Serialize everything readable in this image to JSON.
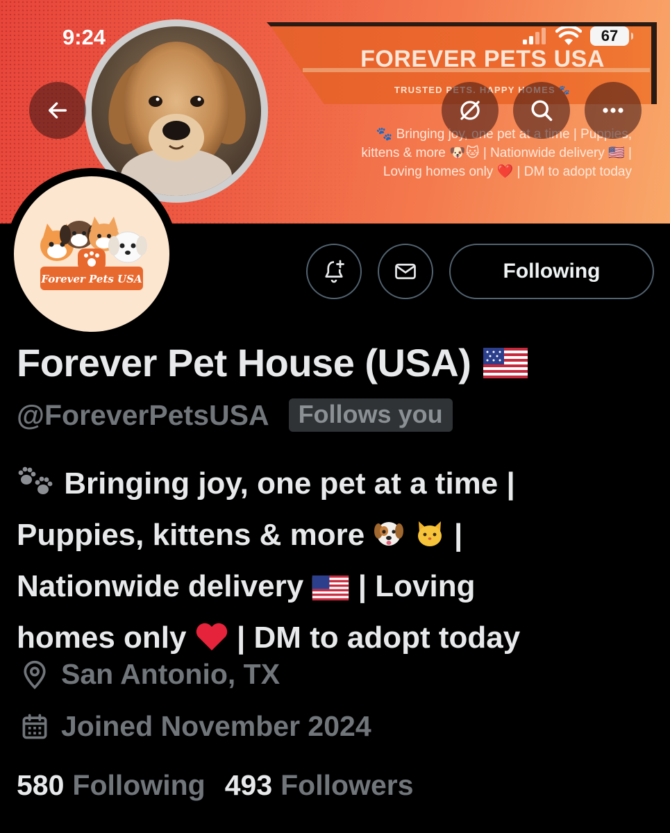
{
  "status_bar": {
    "time": "9:24",
    "battery": "67"
  },
  "banner": {
    "title": "FOREVER PETS USA",
    "tagline": "TRUSTED PETS. HAPPY HOMES",
    "bio_line1": "🐾 Bringing joy, one pet at a time | Puppies,",
    "bio_line2": "kittens & more 🐶🐱 | Nationwide delivery 🇺🇸 |",
    "bio_line3": "Loving homes only ❤️ | DM to adopt today"
  },
  "header_icons": [
    "back-arrow-icon",
    "no-grok-icon",
    "search-icon",
    "more-icon"
  ],
  "avatar": {
    "logo_text": "Forever Pets USA"
  },
  "actions": {
    "following_label": "Following"
  },
  "profile": {
    "name": "Forever Pet House (USA)",
    "handle": "@ForeverPetsUSA",
    "follows_you": "Follows you",
    "bio": {
      "l1_text": "Bringing joy, one pet at a time |",
      "l2_text": "Puppies, kittens & more",
      "l2_end": "|",
      "l3_text": "Nationwide delivery",
      "l3_end": "| Loving",
      "l4_text": "homes only",
      "l4_end": "| DM to adopt today"
    },
    "location": "San Antonio, TX",
    "joined": "Joined November 2024",
    "following_count": "580",
    "following_label": "Following",
    "followers_count": "493",
    "followers_label": "Followers"
  },
  "colors": {
    "accent_text": "#e7e9ea",
    "muted_text": "#71767b",
    "banner_orange": "#ee5c44"
  }
}
